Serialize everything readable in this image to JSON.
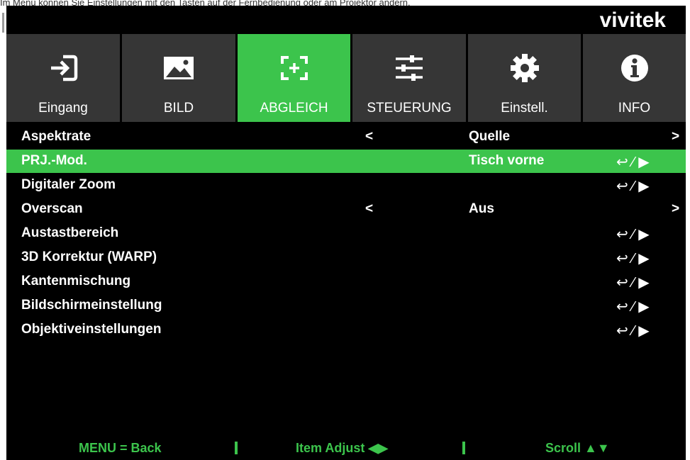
{
  "top_cut_text": "Im Menü können Sie Einstellungen mit den Tasten auf der Fernbedienung oder am Projektor ändern.",
  "brand": {
    "logo": "vivitek",
    "accent": "#3cc44c"
  },
  "tabs": [
    {
      "label": "Eingang",
      "icon": "input-icon"
    },
    {
      "label": "BILD",
      "icon": "image-icon"
    },
    {
      "label": "ABGLEICH",
      "icon": "alignment-icon",
      "active": true
    },
    {
      "label": "STEUERUNG",
      "icon": "sliders-icon"
    },
    {
      "label": "Einstell.",
      "icon": "gear-icon"
    },
    {
      "label": "INFO",
      "icon": "info-icon"
    }
  ],
  "menu": [
    {
      "name": "Aspektrate",
      "left": "<",
      "value": "Quelle",
      "right": ">"
    },
    {
      "name": "PRJ.-Mod.",
      "value": "Tisch vorne",
      "enter": "↩ ⁄ ▶",
      "selected": true
    },
    {
      "name": "Digitaler Zoom",
      "enter": "↩ ⁄ ▶"
    },
    {
      "name": "Overscan",
      "left": "<",
      "value": "Aus",
      "right": ">"
    },
    {
      "name": "Austastbereich",
      "enter": "↩ ⁄ ▶"
    },
    {
      "name": "3D Korrektur (WARP)",
      "enter": "↩ ⁄ ▶"
    },
    {
      "name": "Kantenmischung",
      "enter": "↩ ⁄ ▶"
    },
    {
      "name": "Bildschirmeinstellung",
      "enter": "↩ ⁄ ▶"
    },
    {
      "name": "Objektiveinstellungen",
      "enter": "↩ ⁄ ▶"
    }
  ],
  "footer": {
    "back": "MENU = Back",
    "adjust": "Item Adjust ◀▶",
    "scroll": "Scroll ▲▼"
  }
}
